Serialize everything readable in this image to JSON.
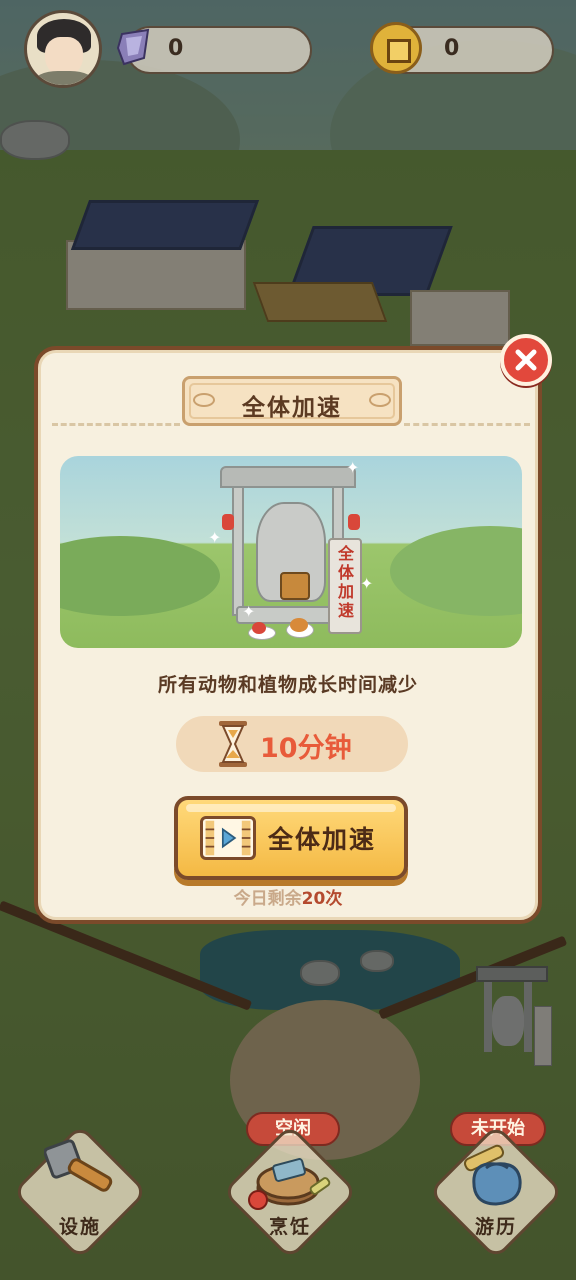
{
  "top_bar": {
    "gem_value": "0",
    "coin_value": "0",
    "avatar_icon": "character-portrait-icon",
    "gem_icon": "crystal-gem-icon",
    "coin_icon": "copper-coin-icon"
  },
  "modal": {
    "title": "全体加速",
    "stele_text": "全体加速",
    "description": "所有动物和植物成长时间减少",
    "timer_value": "10分钟",
    "action_label": "全体加速",
    "remain_prefix": "今日剩余",
    "remain_count": "20次",
    "close_icon": "close-icon",
    "video_icon": "video-ad-icon",
    "timer_icon": "hourglass-icon"
  },
  "bottom_nav": {
    "facilities": {
      "label": "设施",
      "icon": "hammer-icon"
    },
    "cooking": {
      "label": "烹饪",
      "badge": "空闲",
      "icon": "cutting-board-icon"
    },
    "travel": {
      "label": "游历",
      "badge": "未开始",
      "icon": "travel-bag-icon"
    }
  },
  "colors": {
    "accent_red": "#e2483c",
    "button_yellow": "#f4b944",
    "panel_bg": "#f7f0df",
    "timer_text": "#e85b3a"
  }
}
